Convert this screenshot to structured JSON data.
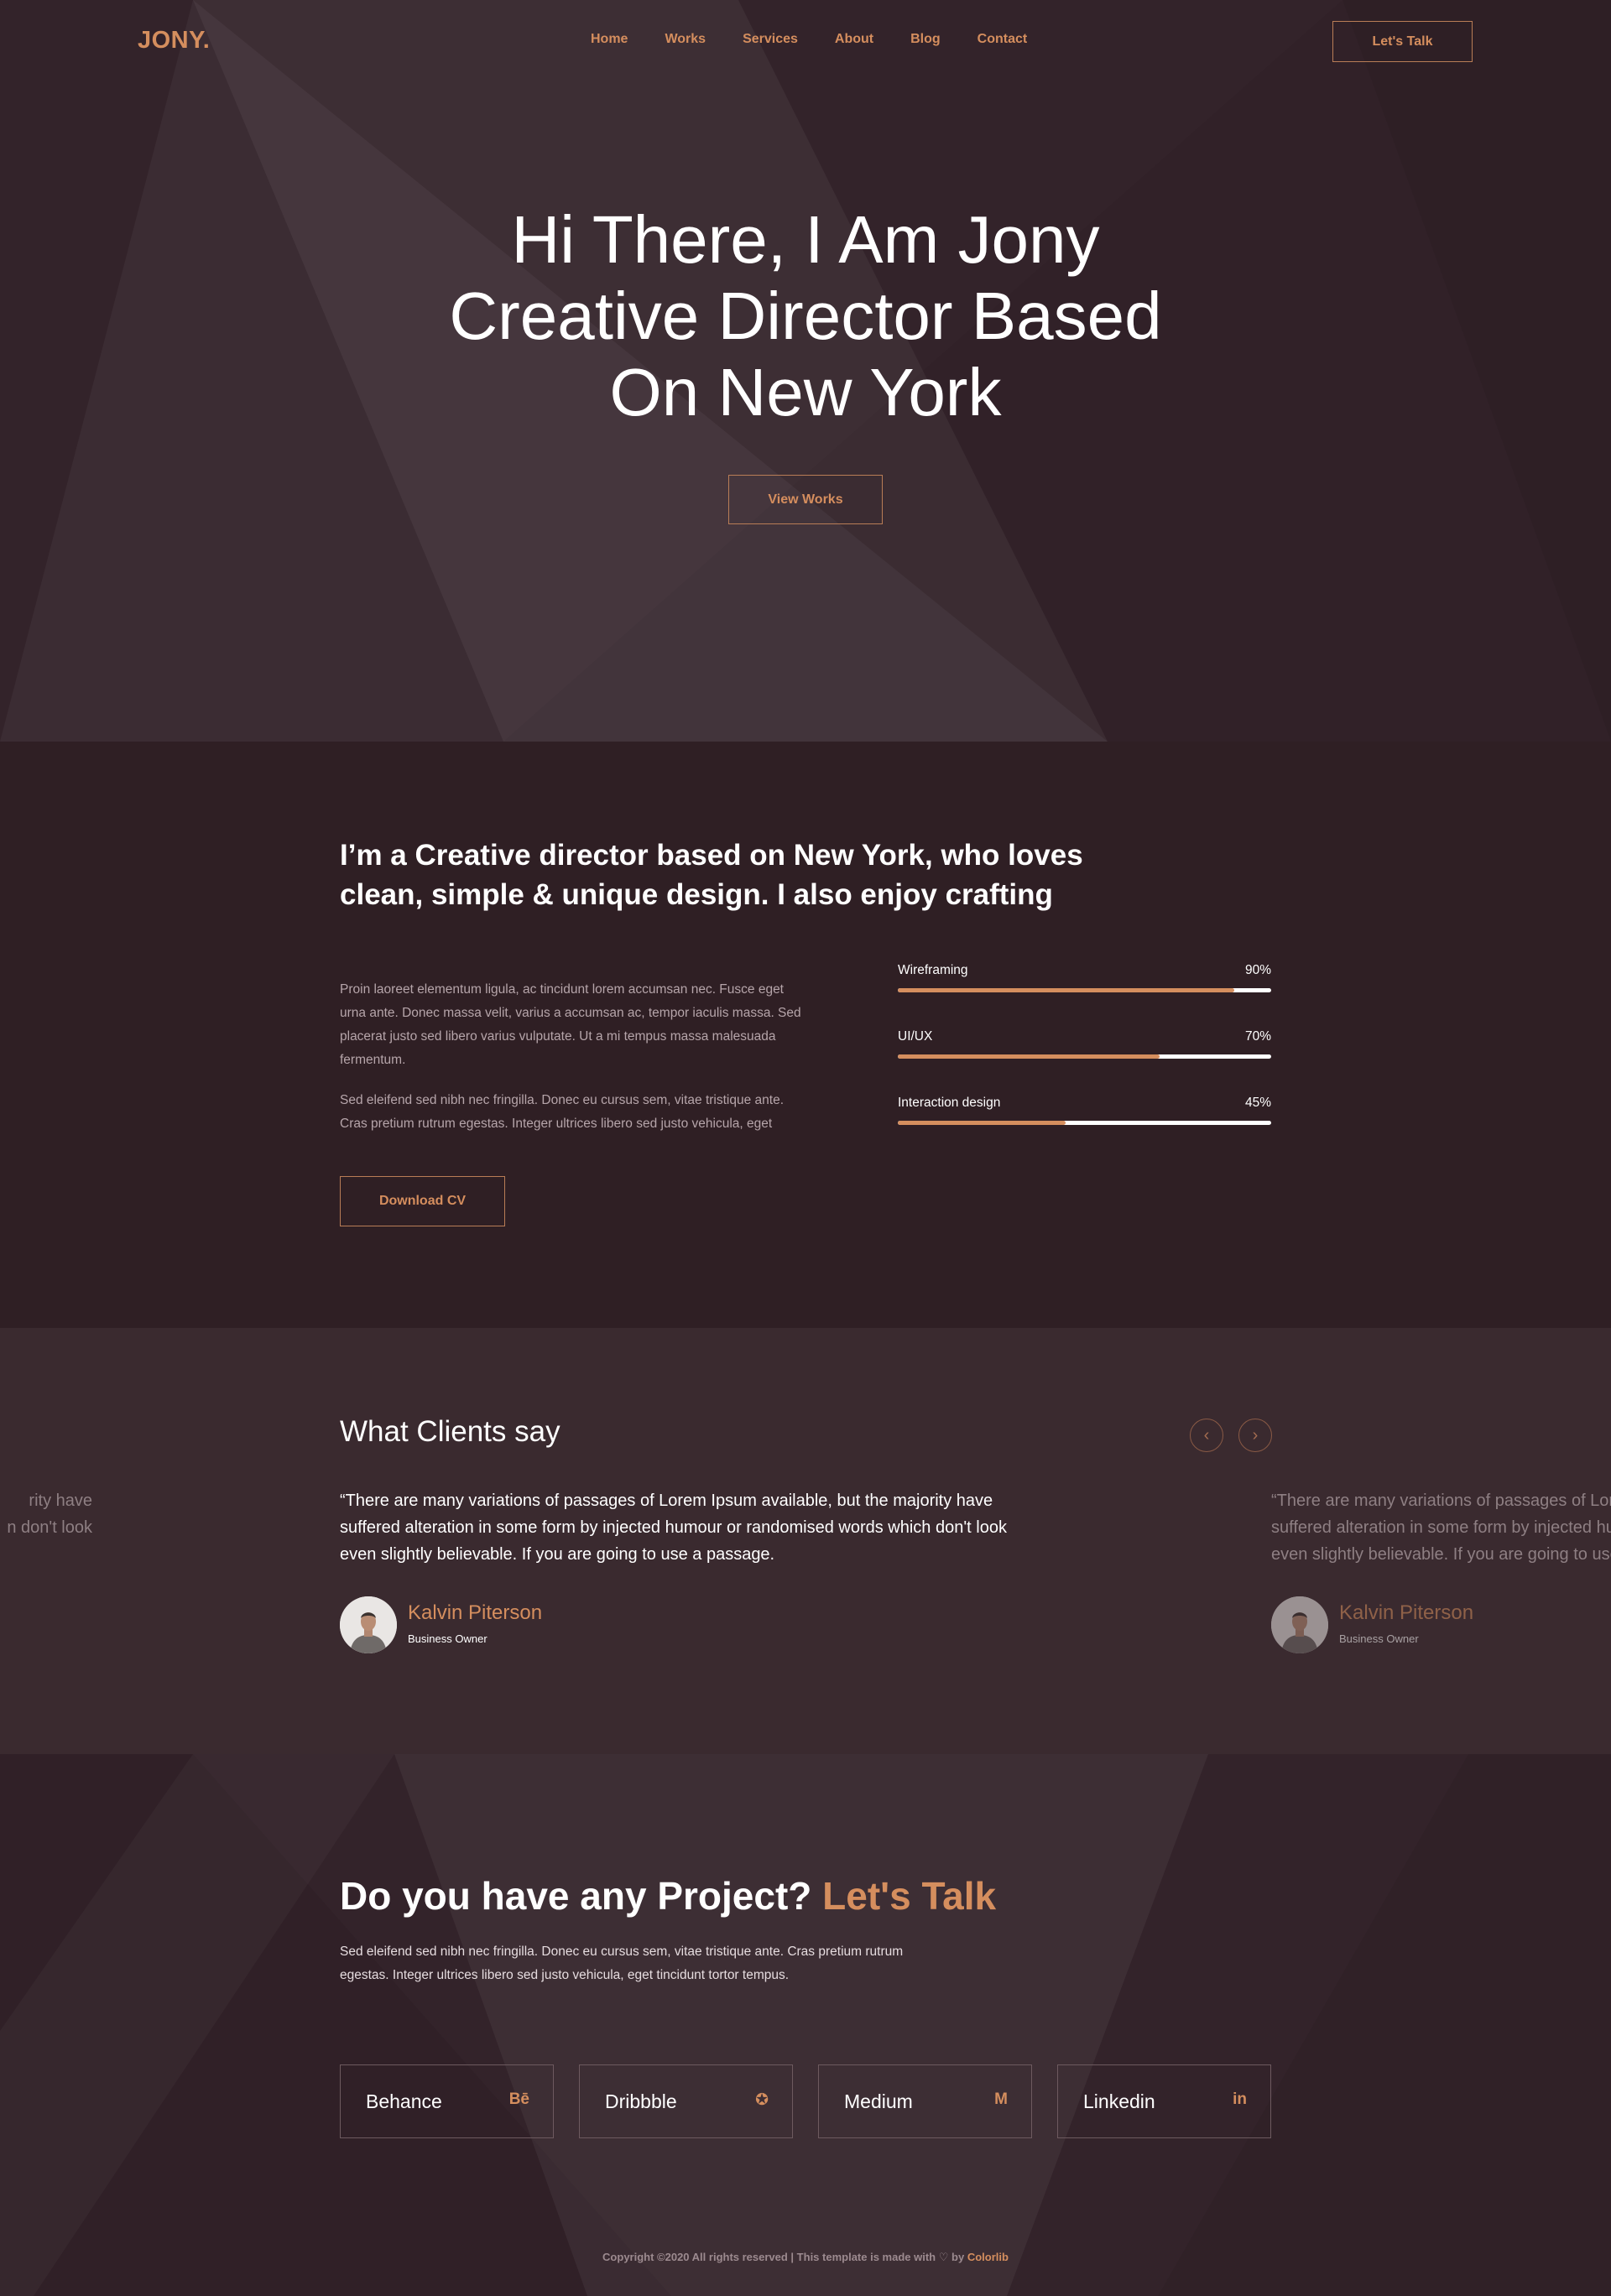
{
  "nav": {
    "logo": "JONY.",
    "menu": [
      "Home",
      "Works",
      "Services",
      "About",
      "Blog",
      "Contact"
    ],
    "cta": "Let's Talk"
  },
  "hero": {
    "title_lines": [
      "Hi There, I Am Jony",
      "Creative Director Based",
      "On New York"
    ],
    "button": "View Works"
  },
  "about": {
    "heading": "I’m a Creative director based on New York, who loves clean, simple & unique design. I also enjoy crafting",
    "paragraph1": "Proin laoreet elementum ligula, ac tincidunt lorem accumsan nec. Fusce eget urna ante. Donec massa velit, varius a accumsan ac, tempor iaculis massa. Sed placerat justo sed libero varius vulputate. Ut a mi tempus massa malesuada fermentum.",
    "paragraph2": "Sed eleifend sed nibh nec fringilla. Donec eu cursus sem, vitae tristique ante. Cras pretium rutrum egestas. Integer ultrices libero sed justo vehicula, eget",
    "button": "Download CV",
    "skills": [
      {
        "name": "Wireframing",
        "percent_label": "90%",
        "value": 0.9
      },
      {
        "name": "UI/UX",
        "percent_label": "70%",
        "value": 0.7
      },
      {
        "name": "Interaction design",
        "percent_label": "45%",
        "value": 0.45
      }
    ]
  },
  "testimonials": {
    "title": "What Clients say",
    "quote": "“There are many variations of passages of Lorem Ipsum available, but the majority have suffered alteration in some form by injected humour or randomised words which don't look even slightly believable. If you are going to use a passage.",
    "prev_quote_fragment": "rity have\nn don't look",
    "next_quote_lines": [
      "“There are many variations of passages of Lor",
      "suffered alteration in some form by injected hu",
      "even slightly believable. If you are going to use"
    ],
    "author_name": "Kalvin Piterson",
    "author_role": "Business Owner"
  },
  "contact": {
    "title_main": "Do you have any Project?",
    "title_accent": "Let's Talk",
    "text": "Sed eleifend sed nibh nec fringilla. Donec eu cursus sem, vitae tristique ante. Cras pretium rutrum egestas. Integer ultrices libero sed justo vehicula, eget tincidunt tortor tempus.",
    "socials": [
      {
        "label": "Behance",
        "icon": "Bē"
      },
      {
        "label": "Dribbble",
        "icon": "✪"
      },
      {
        "label": "Medium",
        "icon": "M"
      },
      {
        "label": "Linkedin",
        "icon": "in"
      }
    ]
  },
  "footer": {
    "text_before": "Copyright ©2020 All rights reserved | This template is made with",
    "heart": "♡",
    "by": "by",
    "brand": "Colorlib"
  },
  "colors": {
    "accent": "#d58e5e",
    "background": "#2f1f24",
    "panel": "#3a2a2f"
  }
}
